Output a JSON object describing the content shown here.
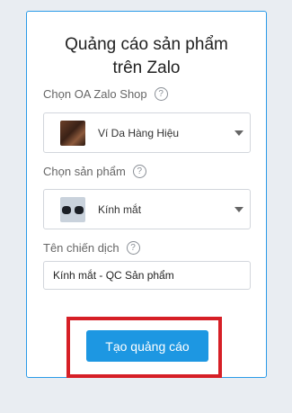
{
  "form": {
    "title_line1": "Quảng cáo sản phẩm",
    "title_line2": "trên Zalo",
    "shop_label": "Chọn OA Zalo Shop",
    "shop_value": "Ví Da Hàng Hiệu",
    "product_label": "Chọn sản phẩm",
    "product_value": "Kính mắt",
    "campaign_label": "Tên chiến dịch",
    "campaign_value": "Kính mắt - QC Sản phẩm",
    "help_glyph": "?",
    "submit_label": "Tạo quảng cáo"
  },
  "colors": {
    "accent": "#1d97e2",
    "highlight": "#d61f26",
    "card_border": "#2b9be8"
  },
  "icons": {
    "help": "question-circle-icon",
    "dropdown": "caret-down-icon"
  }
}
